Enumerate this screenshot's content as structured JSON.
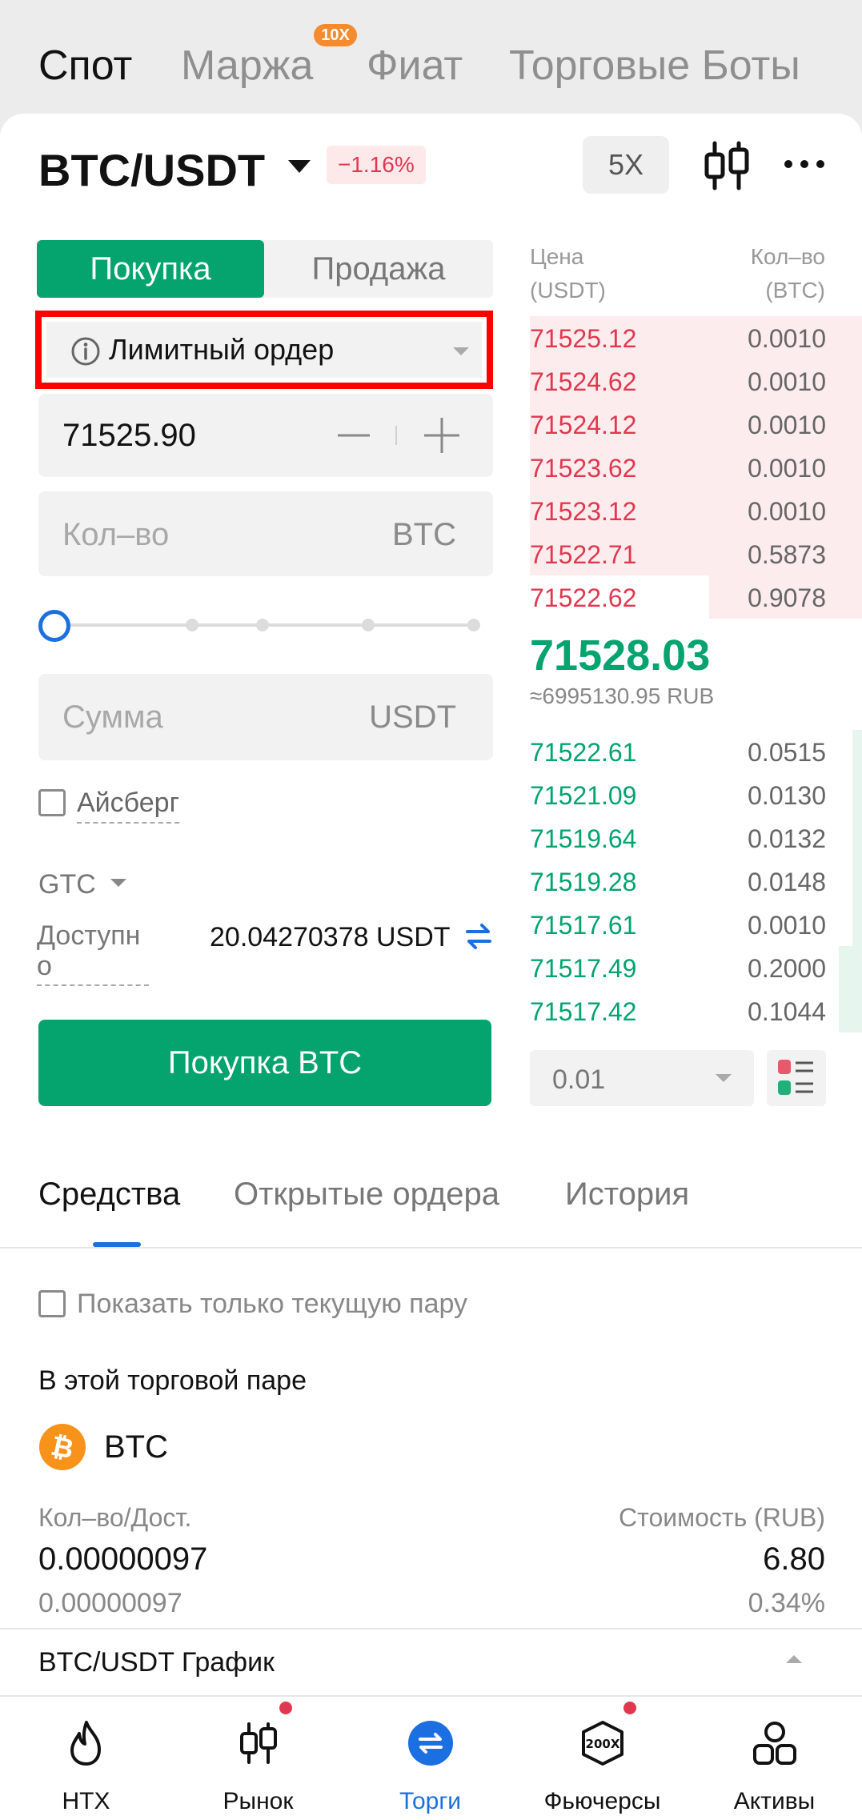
{
  "top_tabs": [
    {
      "label": "Спот",
      "active": true
    },
    {
      "label": "Маржа",
      "active": false
    },
    {
      "label": "Фиат",
      "active": false
    },
    {
      "label": "Торговые Боты",
      "active": false
    }
  ],
  "margin_badge": "10X",
  "header": {
    "pair": "BTC/USDT",
    "change": "−1.16%",
    "leverage": "5X"
  },
  "order_form": {
    "buy_label": "Покупка",
    "sell_label": "Продажа",
    "order_type": "Лимитный ордер",
    "price": "71525.90",
    "qty_placeholder": "Кол–во",
    "qty_unit": "BTC",
    "slider_percent": 0,
    "sum_placeholder": "Сумма",
    "sum_unit": "USDT",
    "iceberg_label": "Айсберг",
    "tif": "GTC",
    "available_label": "Доступно",
    "available_value": "20.04270378 USDT",
    "submit_label": "Покупка BTC"
  },
  "order_book": {
    "price_header_1": "Цена",
    "price_header_2": "(USDT)",
    "qty_header_1": "Кол–во",
    "qty_header_2": "(BTC)",
    "asks": [
      {
        "price": "71525.12",
        "qty": "0.0010",
        "depth": 1.0
      },
      {
        "price": "71524.62",
        "qty": "0.0010",
        "depth": 1.0
      },
      {
        "price": "71524.12",
        "qty": "0.0010",
        "depth": 1.0
      },
      {
        "price": "71523.62",
        "qty": "0.0010",
        "depth": 1.0
      },
      {
        "price": "71523.12",
        "qty": "0.0010",
        "depth": 1.0
      },
      {
        "price": "71522.71",
        "qty": "0.5873",
        "depth": 1.0
      },
      {
        "price": "71522.62",
        "qty": "0.9078",
        "depth": 0.46
      }
    ],
    "last_price": "71528.03",
    "last_price_fiat": "≈6995130.95 RUB",
    "bids": [
      {
        "price": "71522.61",
        "qty": "0.0515",
        "depth": 0.03
      },
      {
        "price": "71521.09",
        "qty": "0.0130",
        "depth": 0.03
      },
      {
        "price": "71519.64",
        "qty": "0.0132",
        "depth": 0.03
      },
      {
        "price": "71519.28",
        "qty": "0.0148",
        "depth": 0.03
      },
      {
        "price": "71517.61",
        "qty": "0.0010",
        "depth": 0.03
      },
      {
        "price": "71517.49",
        "qty": "0.2000",
        "depth": 0.07
      },
      {
        "price": "71517.42",
        "qty": "0.1044",
        "depth": 0.07
      }
    ],
    "depth_step": "0.01"
  },
  "assets_tabs": [
    {
      "label": "Средства",
      "active": true
    },
    {
      "label": "Открытые ордера",
      "active": false
    },
    {
      "label": "История",
      "active": false
    }
  ],
  "assets": {
    "show_pair_only": "Показать только текущую пару",
    "section_title": "В этой торговой паре",
    "coin": "BTC",
    "qty_header": "Кол–во/Дост.",
    "value_header": "Стоимость (RUB)",
    "qty_total": "0.00000097",
    "value_total": "6.80",
    "qty_available": "0.00000097",
    "value_percent": "0.34%"
  },
  "chart_bar_label": "BTC/USDT График",
  "bottom_nav": [
    {
      "label": "HTX",
      "icon": "flame-icon"
    },
    {
      "label": "Рынок",
      "icon": "candlestick-icon"
    },
    {
      "label": "Торги",
      "icon": "swap-circle-icon"
    },
    {
      "label": "Фьючерсы",
      "icon": "futures-200x-icon"
    },
    {
      "label": "Активы",
      "icon": "assets-icon"
    }
  ],
  "colors": {
    "buy_green": "#05a36e",
    "sell_red": "#e0394f",
    "accent_blue": "#1b6fe0",
    "highlight_box": "#ff0000"
  }
}
